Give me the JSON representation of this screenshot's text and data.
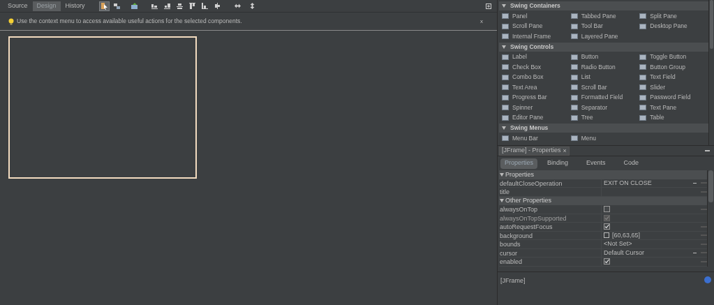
{
  "editor_tabs": [
    {
      "label": "Source",
      "selected": false
    },
    {
      "label": "Design",
      "selected": true
    },
    {
      "label": "History",
      "selected": false
    }
  ],
  "toolbar": [
    {
      "kind": "select",
      "selected": true
    },
    {
      "kind": "connect",
      "selected": false
    },
    {
      "kind": "preview",
      "selected": false
    },
    {
      "kind": "align-left",
      "selected": false
    },
    {
      "kind": "align-right",
      "selected": false
    },
    {
      "kind": "center-h",
      "selected": false
    },
    {
      "kind": "align-top",
      "selected": false
    },
    {
      "kind": "align-bottom",
      "selected": false
    },
    {
      "kind": "center-v",
      "selected": false
    },
    {
      "kind": "resize-h",
      "selected": false
    },
    {
      "kind": "resize-v",
      "selected": false
    }
  ],
  "hint": {
    "text": "Use the context menu to access available useful actions for the selected components.",
    "close": "x"
  },
  "palette": [
    {
      "title": "Swing Containers",
      "items": [
        "Panel",
        "Tabbed Pane",
        "Split Pane",
        "Scroll Pane",
        "Tool Bar",
        "Desktop Pane",
        "Internal Frame",
        "Layered Pane"
      ]
    },
    {
      "title": "Swing Controls",
      "items": [
        "Label",
        "Button",
        "Toggle Button",
        "Check Box",
        "Radio Button",
        "Button Group",
        "Combo Box",
        "List",
        "Text Field",
        "Text Area",
        "Scroll Bar",
        "Slider",
        "Progress Bar",
        "Formatted Field",
        "Password Field",
        "Spinner",
        "Separator",
        "Text Pane",
        "Editor Pane",
        "Tree",
        "Table"
      ]
    },
    {
      "title": "Swing Menus",
      "items": [
        "Menu Bar",
        "Menu"
      ]
    }
  ],
  "properties_panel": {
    "title": "[JFrame] - Properties",
    "close": "×",
    "tabs": [
      {
        "label": "Properties",
        "selected": true
      },
      {
        "label": "Binding",
        "selected": false
      },
      {
        "label": "Events",
        "selected": false
      },
      {
        "label": "Code",
        "selected": false
      }
    ],
    "rows": [
      {
        "kind": "section",
        "label": "Properties"
      },
      {
        "kind": "text",
        "name": "defaultCloseOperation",
        "value": "EXIT ON CLOSE",
        "dropdown": true,
        "editor_button": true
      },
      {
        "kind": "text",
        "name": "title",
        "dropdown": false,
        "editor_button": true
      },
      {
        "kind": "section",
        "label": "Other Properties"
      },
      {
        "kind": "checkbox",
        "name": "alwaysOnTop",
        "checked": false,
        "disabled": false,
        "editor_button": true
      },
      {
        "kind": "checkbox",
        "name": "alwaysOnTopSupported",
        "checked": true,
        "disabled": true,
        "editor_button": false
      },
      {
        "kind": "checkbox",
        "name": "autoRequestFocus",
        "checked": true,
        "disabled": false,
        "editor_button": true
      },
      {
        "kind": "color",
        "name": "background",
        "value": "[60,63,65]",
        "editor_button": true
      },
      {
        "kind": "text",
        "name": "bounds",
        "value": "<Not Set>",
        "dropdown": false,
        "editor_button": true
      },
      {
        "kind": "text",
        "name": "cursor",
        "value": "Default Cursor",
        "dropdown": true,
        "editor_button": true
      },
      {
        "kind": "checkbox",
        "name": "enabled",
        "checked": true,
        "disabled": false,
        "editor_button": true
      }
    ],
    "description": "[JFrame]"
  }
}
